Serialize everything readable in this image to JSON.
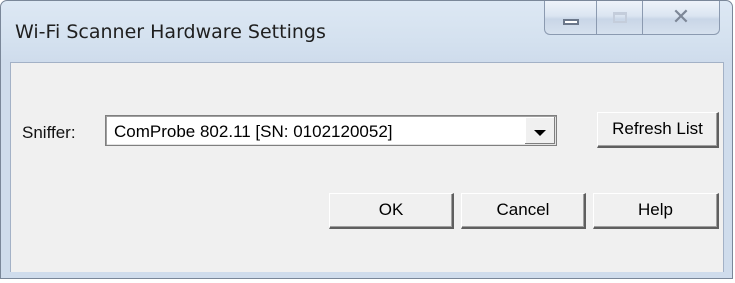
{
  "window": {
    "title": "Wi-Fi Scanner Hardware Settings",
    "caption_buttons": {
      "minimize_icon": "minimize-icon",
      "maximize_icon": "maximize-icon",
      "close_glyph": "✕"
    }
  },
  "form": {
    "sniffer_label": "Sniffer:",
    "sniffer_value": "ComProbe 802.11 [SN: 0102120052]",
    "dropdown_icon": "dropdown-arrow-icon"
  },
  "buttons": {
    "refresh_label": "Refresh List",
    "ok_label": "OK",
    "cancel_label": "Cancel",
    "help_label": "Help"
  },
  "colors": {
    "frame": "#d4e1ef",
    "client": "#f0f0f0"
  }
}
